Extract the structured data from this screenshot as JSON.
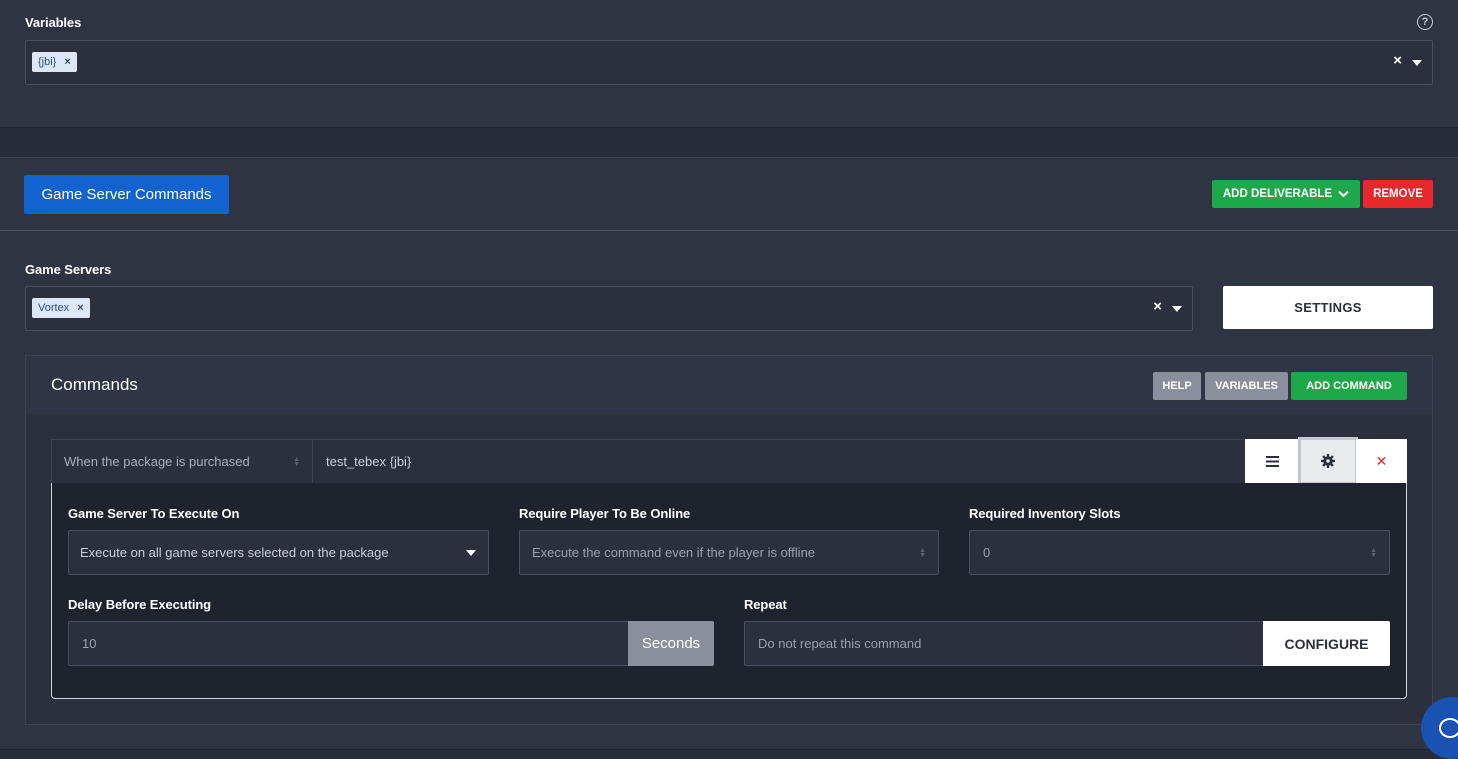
{
  "variables": {
    "label": "Variables",
    "help_icon": "question-circle-icon",
    "tags": [
      "{jbi}"
    ],
    "clear": "×"
  },
  "section": {
    "title_button": "Game Server Commands",
    "add_deliverable": "ADD DELIVERABLE",
    "remove": "REMOVE",
    "colors": {
      "primary": "#1262cf",
      "success": "#1ea84a",
      "danger": "#e8282b",
      "muted": "#8a8f9c"
    }
  },
  "game_servers": {
    "label": "Game Servers",
    "tags": [
      "Vortex"
    ],
    "clear": "×",
    "settings": "SETTINGS"
  },
  "commands": {
    "title": "Commands",
    "help": "HELP",
    "variables": "VARIABLES",
    "add_command": "ADD COMMAND",
    "row": {
      "trigger": "When the package is purchased",
      "command": "test_tebex {jbi}",
      "menu_icon": "hamburger-icon",
      "settings_icon": "gear-icon",
      "delete_icon": "close-icon",
      "delete_symbol": "✕"
    },
    "detail": {
      "execute_on_label": "Game Server To Execute On",
      "execute_on_value": "Execute on all game servers selected on the package",
      "online_label": "Require Player To Be Online",
      "online_value": "Execute the command even if the player is offline",
      "slots_label": "Required Inventory Slots",
      "slots_value": "0",
      "delay_label": "Delay Before Executing",
      "delay_value": "10",
      "delay_unit": "Seconds",
      "repeat_label": "Repeat",
      "repeat_value": "Do not repeat this command",
      "configure": "CONFIGURE"
    }
  },
  "chat_widget_icon": "chat-bubble-icon"
}
